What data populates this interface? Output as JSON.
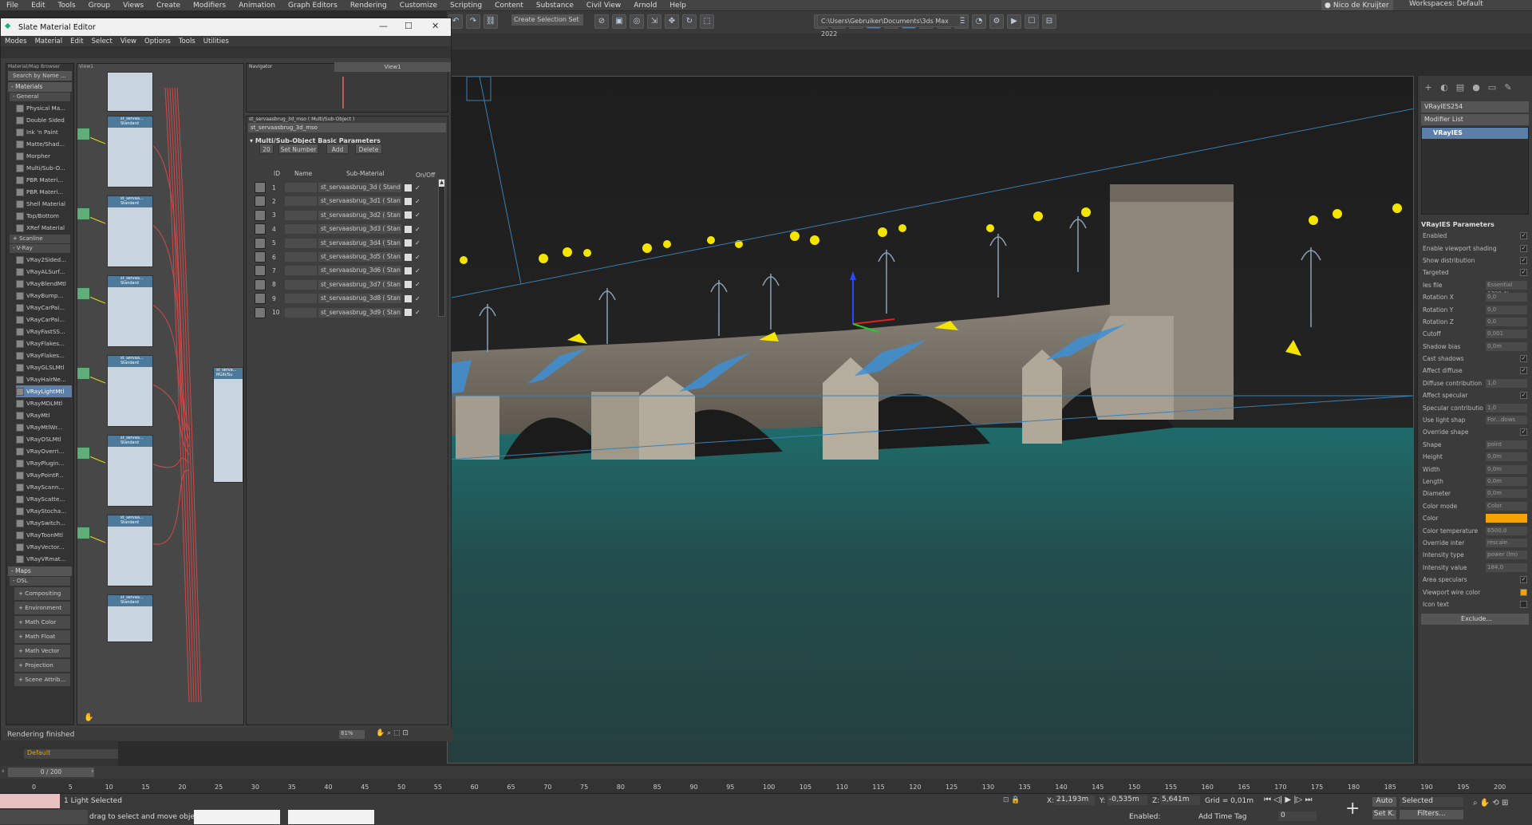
{
  "menubar": {
    "items": [
      "File",
      "Edit",
      "Tools",
      "Group",
      "Views",
      "Create",
      "Modifiers",
      "Animation",
      "Graph Editors",
      "Rendering",
      "Customize",
      "Scripting",
      "Content",
      "Substance",
      "Civil View",
      "Arnold",
      "Help"
    ],
    "user": "Nico de Kruijter",
    "workspaces_label": "Workspaces:",
    "workspace_value": "Default"
  },
  "toolbar": {
    "selection_set": "Create Selection Set",
    "path": "C:\\Users\\Gebruiker\\Documents\\3ds Max 2022"
  },
  "slate": {
    "title": "Slate Material Editor",
    "menu": [
      "Modes",
      "Material",
      "Edit",
      "Select",
      "View",
      "Options",
      "Tools",
      "Utilities"
    ],
    "browser_header": "Material/Map Browser",
    "search_placeholder": "Search by Name ...",
    "materials_group": "- Materials",
    "general_group": "- General",
    "general_items": [
      "Physical Ma...",
      "Double Sided",
      "Ink 'n Paint",
      "Matte/Shad...",
      "Morpher",
      "Multi/Sub-O...",
      "PBR Materi...",
      "PBR Materi...",
      "Shell Material",
      "Top/Bottom",
      "XRef Material"
    ],
    "scanline_group": "+ Scanline",
    "vray_group": "- V-Ray",
    "vray_items": [
      "VRay2Sided...",
      "VRayALSurf...",
      "VRayBlendMtl",
      "VRayBump...",
      "VRayCarPai...",
      "VRayCarPai...",
      "VRayFastSS...",
      "VRayFlakes...",
      "VRayFlakes...",
      "VRayGLSLMtl",
      "VRayHairNe...",
      "VRayLightMtl",
      "VRayMDLMtl",
      "VRayMtl",
      "VRayMtlWr...",
      "VRayOSLMtl",
      "VRayOverri...",
      "VRayPlugin...",
      "VRayPointP...",
      "VRayScann...",
      "VRayScatte...",
      "VRayStocha...",
      "VRaySwitch...",
      "VRayToonMtl",
      "VRayVector...",
      "VRayVRmat..."
    ],
    "maps_group": "- Maps",
    "osl_group": "- OSL",
    "osl_items": [
      "+ Compositing",
      "+ Environment",
      "+ Math Color",
      "+ Math Float",
      "+ Math Vector",
      "+ Projection",
      "+ Scene Attrib..."
    ],
    "view_tab": "View1",
    "view_dropdown": "View1",
    "navigator_title": "Navigator",
    "node_label": "st_servaa... Standard",
    "multi_node_label": "st_serva... Multi/Su",
    "status": "Rendering finished",
    "zoom": "81%"
  },
  "params": {
    "header": "st_servaasbrug_3d_mso ( Multi/Sub-Object )",
    "name_value": "st_servaasbrug_3d_mso",
    "rollout_title": "Multi/Sub-Object Basic Parameters",
    "count_value": "20",
    "set_number": "Set Number",
    "add": "Add",
    "delete": "Delete",
    "col_id": "ID",
    "col_name": "Name",
    "col_sub": "Sub-Material",
    "col_onoff": "On/Off",
    "rows": [
      {
        "id": "1",
        "sub": "st_servaasbrug_3d  ( Stand"
      },
      {
        "id": "2",
        "sub": "st_servaasbrug_3d1  ( Stan"
      },
      {
        "id": "3",
        "sub": "st_servaasbrug_3d2  ( Stan"
      },
      {
        "id": "4",
        "sub": "st_servaasbrug_3d3  ( Stan"
      },
      {
        "id": "5",
        "sub": "st_servaasbrug_3d4  ( Stan"
      },
      {
        "id": "6",
        "sub": "st_servaasbrug_3d5  ( Stan"
      },
      {
        "id": "7",
        "sub": "st_servaasbrug_3d6  ( Stan"
      },
      {
        "id": "8",
        "sub": "st_servaasbrug_3d7  ( Stan"
      },
      {
        "id": "9",
        "sub": "st_servaasbrug_3d8  ( Stan"
      },
      {
        "id": "10",
        "sub": "st_servaasbrug_3d9  ( Stan"
      }
    ]
  },
  "cmdpanel": {
    "object_name": "VRayIES254",
    "modifier_list": "Modifier List",
    "stack_item": "VRayIES",
    "rollout_title": "VRayIES Parameters",
    "params": [
      {
        "label": "Enabled",
        "value": "",
        "check": "✓"
      },
      {
        "label": "Enable viewport shading",
        "value": "",
        "check": "✓"
      },
      {
        "label": "Show distribution",
        "value": "",
        "check": "✓"
      },
      {
        "label": "Targeted",
        "value": "",
        "check": "✓"
      },
      {
        "label": "Ies file",
        "value": "Essential 1200 4(",
        "check": ""
      },
      {
        "label": "Rotation X",
        "value": "0,0",
        "check": ""
      },
      {
        "label": "Rotation Y",
        "value": "0,0",
        "check": ""
      },
      {
        "label": "Rotation Z",
        "value": "0,0",
        "check": ""
      },
      {
        "label": "Cutoff",
        "value": "0,001",
        "check": ""
      },
      {
        "label": "Shadow bias",
        "value": "0,0m",
        "check": ""
      },
      {
        "label": "Cast shadows",
        "value": "",
        "check": "✓"
      },
      {
        "label": "Affect diffuse",
        "value": "",
        "check": "✓"
      },
      {
        "label": "Diffuse contribution",
        "value": "1,0",
        "check": ""
      },
      {
        "label": "Affect specular",
        "value": "",
        "check": "✓"
      },
      {
        "label": "Specular contributio",
        "value": "1,0",
        "check": ""
      },
      {
        "label": "Use light shap",
        "value": "For...dows",
        "check": ""
      },
      {
        "label": "Override shape",
        "value": "",
        "check": "✓"
      },
      {
        "label": "Shape",
        "value": "point",
        "check": ""
      },
      {
        "label": "Height",
        "value": "0,0m",
        "check": ""
      },
      {
        "label": "Width",
        "value": "0,0m",
        "check": ""
      },
      {
        "label": "Length",
        "value": "0,0m",
        "check": ""
      },
      {
        "label": "Diameter",
        "value": "0,0m",
        "check": ""
      },
      {
        "label": "Color mode",
        "value": "Color",
        "check": ""
      },
      {
        "label": "Color",
        "value": "",
        "check": ""
      },
      {
        "label": "Color temperature",
        "value": "6500,0",
        "check": ""
      },
      {
        "label": "Override inter",
        "value": "rescale",
        "check": ""
      },
      {
        "label": "Intensity type",
        "value": "power (lm)",
        "check": ""
      },
      {
        "label": "Intensity value",
        "value": "184,0",
        "check": ""
      },
      {
        "label": "Area speculars",
        "value": "",
        "check": "✓"
      },
      {
        "label": "Viewport wire color",
        "value": "",
        "check": ""
      },
      {
        "label": "Icon text",
        "value": "",
        "check": ""
      }
    ],
    "exclude": "Exclude...",
    "color": "#f5a300"
  },
  "viewport": {
    "layer": "Default"
  },
  "timeline": {
    "frame": "0 / 200",
    "ticks": [
      "0",
      "5",
      "10",
      "15",
      "20",
      "25",
      "30",
      "35",
      "40",
      "45",
      "50",
      "55",
      "60",
      "65",
      "70",
      "75",
      "80",
      "85",
      "90",
      "95",
      "100",
      "105",
      "110",
      "115",
      "120",
      "125",
      "130",
      "135",
      "140",
      "145",
      "150",
      "155",
      "160",
      "165",
      "170",
      "175",
      "180",
      "185",
      "190",
      "195",
      "200"
    ]
  },
  "status": {
    "selected": "1 Light Selected",
    "prompt": "drag to select and move objects",
    "x_label": "X:",
    "x": "21,193m",
    "y_label": "Y:",
    "y": "-0,535m",
    "z_label": "Z:",
    "z": "5,641m",
    "grid": "Grid = 0,01m",
    "enabled_label": "Enabled:",
    "add_time_tag": "Add Time Tag",
    "auto": "Auto",
    "selected_dd": "Selected",
    "setk": "Set K.",
    "filters": "Filters...",
    "frame_field": "0"
  }
}
